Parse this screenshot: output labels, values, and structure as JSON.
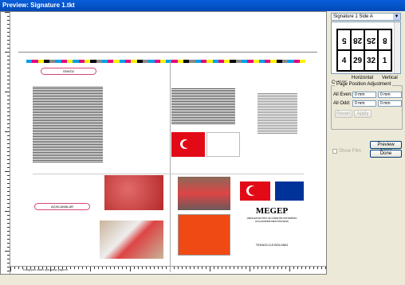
{
  "window": {
    "title": "Preview: Signature 1.tkt"
  },
  "side_panel": {
    "signature_select": "Signature 1 Side A",
    "thumbnail_cells": [
      {
        "text": "5",
        "flipped": true
      },
      {
        "text": "28",
        "flipped": true
      },
      {
        "text": "25",
        "flipped": true
      },
      {
        "text": "8",
        "flipped": true
      },
      {
        "text": "4",
        "flipped": false
      },
      {
        "text": "29",
        "flipped": false
      },
      {
        "text": "32",
        "flipped": false
      },
      {
        "text": "1",
        "flipped": false
      }
    ],
    "horizontal_label": "Horizontal",
    "vertical_label": "Vertical",
    "cursor_label": "Cursor:",
    "page_position_group": "Page Position Adjustment",
    "all_even_label": "All Even:",
    "all_odd_label": "All Odd:",
    "all_even_x": "0 mm",
    "all_even_y": "0 mm",
    "all_odd_x": "0 mm",
    "all_odd_y": "0 mm",
    "revert_button": "Revert",
    "apply_button": "Apply",
    "preview_again_button": "Preview Again",
    "done_button": "Done",
    "show_film_label": "Show Film"
  },
  "preview": {
    "pill_top_left": "ÖNSÖZ",
    "pill_bottom_left": "AÇIKLAMALAR",
    "megep_title": "MEGEP",
    "megep_sub": "(MESLEKİ EĞİTİM VE ÖĞRETİM SİSTEMİNİN GÜÇLENDİRİLMESİ PROJESİ)",
    "bottom_center_text": "TEKNOLOJİ BÖLÜMÜ",
    "footer_left": "Kalıpçılık alanı için kalıp yapımı"
  },
  "colors": {
    "title_bar": "#0A5FD9",
    "turkey_red": "#E30A17",
    "eu_blue": "#003399",
    "pill_border": "#d8467a",
    "panel_bg": "#ECE9D8"
  }
}
